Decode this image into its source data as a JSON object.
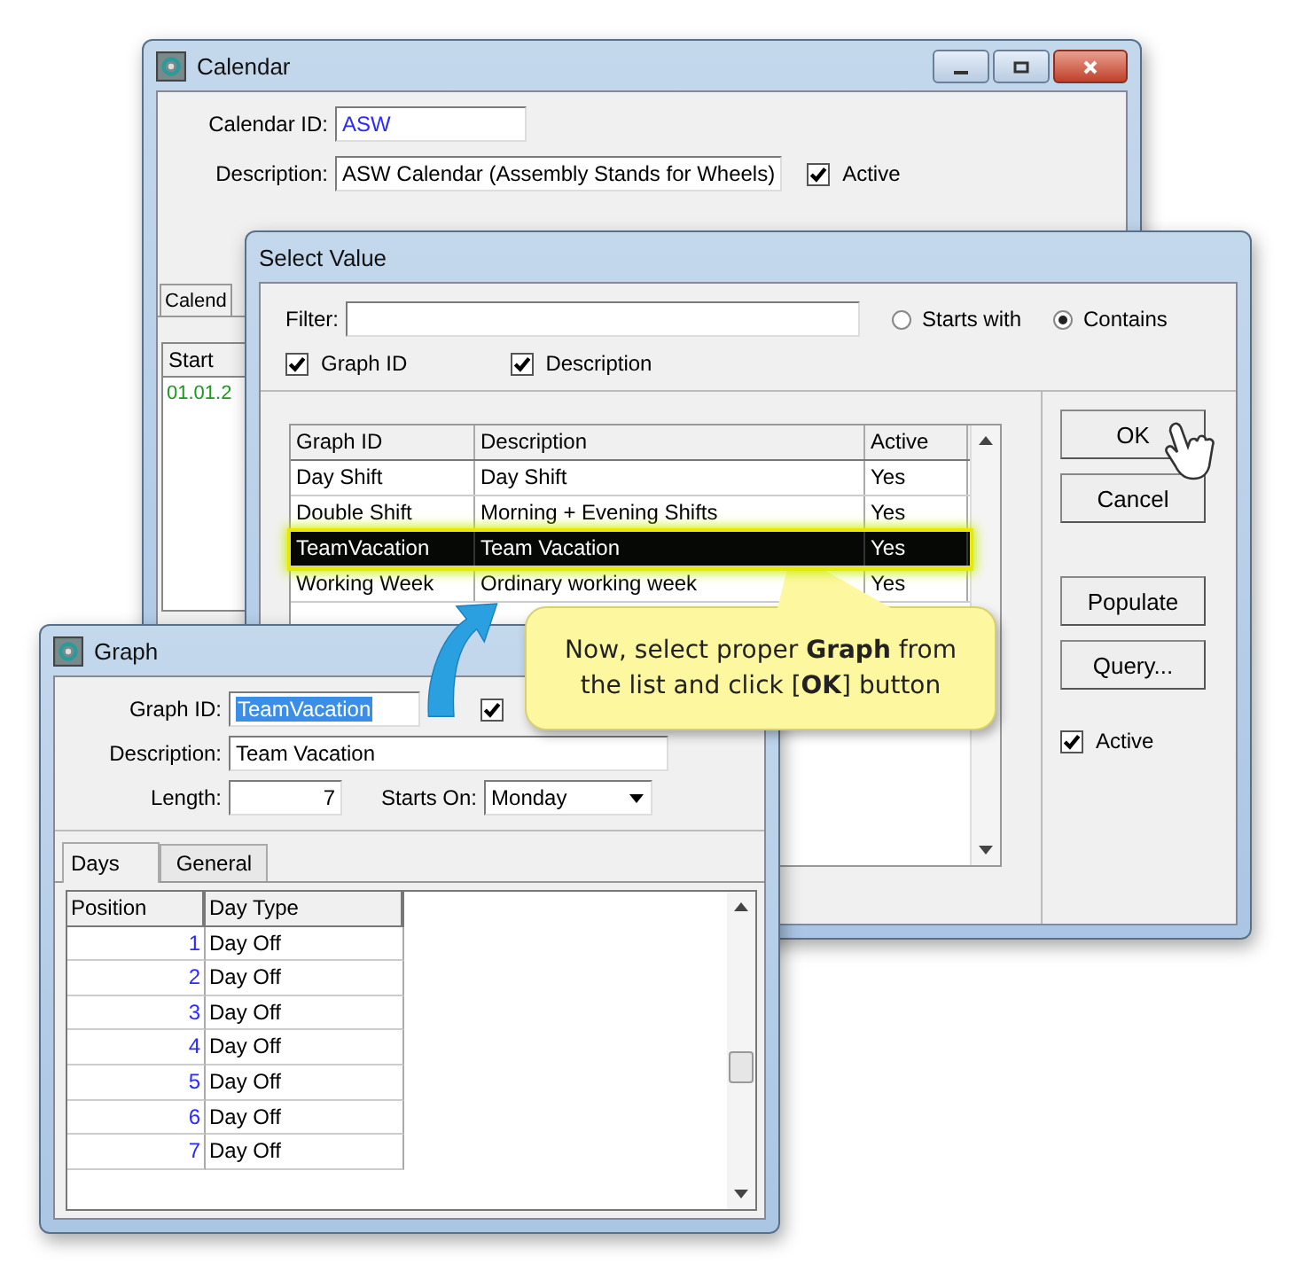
{
  "calendar_window": {
    "title": "Calendar",
    "calendar_id_label": "Calendar ID:",
    "calendar_id": "ASW",
    "description_label": "Description:",
    "description": "ASW Calendar (Assembly Stands for Wheels)",
    "active": {
      "label": "Active",
      "checked": true
    },
    "tab": "Calend",
    "table": {
      "column_1": "Start",
      "rows": [
        "01.01.2"
      ]
    }
  },
  "select_value_window": {
    "title": "Select Value",
    "filter_label": "Filter:",
    "match_options": [
      {
        "label": "Starts with",
        "selected": false
      },
      {
        "label": "Contains",
        "selected": true
      }
    ],
    "search_fields": [
      {
        "label": "Graph ID",
        "checked": true
      },
      {
        "label": "Description",
        "checked": true
      }
    ],
    "table": {
      "columns": [
        "Graph ID",
        "Description",
        "Active"
      ],
      "rows": [
        {
          "cells": [
            "Day Shift",
            "Day Shift",
            "Yes"
          ],
          "selected": false
        },
        {
          "cells": [
            "Double Shift",
            "Morning + Evening Shifts",
            "Yes"
          ],
          "selected": false
        },
        {
          "cells": [
            "TeamVacation",
            "Team Vacation",
            "Yes"
          ],
          "selected": true
        },
        {
          "cells": [
            "Working Week",
            "Ordinary working week",
            "Yes"
          ],
          "selected": false
        }
      ]
    },
    "buttons": [
      "OK",
      "Cancel",
      "Populate",
      "Query..."
    ],
    "active": {
      "label": "Active",
      "checked": true
    }
  },
  "graph_window": {
    "title": "Graph",
    "graph_id_label": "Graph ID:",
    "graph_id": "TeamVacation",
    "active_checked": true,
    "description_label": "Description:",
    "description": "Team Vacation",
    "length_label": "Length:",
    "length": "7",
    "starts_on_label": "Starts On:",
    "starts_on": "Monday",
    "tabs": [
      {
        "label": "Days",
        "selected": true
      },
      {
        "label": "General",
        "selected": false
      }
    ],
    "table": {
      "columns": [
        "Position",
        "Day Type"
      ],
      "rows": [
        [
          "1",
          "Day Off"
        ],
        [
          "2",
          "Day Off"
        ],
        [
          "3",
          "Day Off"
        ],
        [
          "4",
          "Day Off"
        ],
        [
          "5",
          "Day Off"
        ],
        [
          "6",
          "Day Off"
        ],
        [
          "7",
          "Day Off"
        ]
      ]
    }
  },
  "callout": {
    "text": "Now, select proper **Graph** from the list and click [**OK**] button"
  }
}
